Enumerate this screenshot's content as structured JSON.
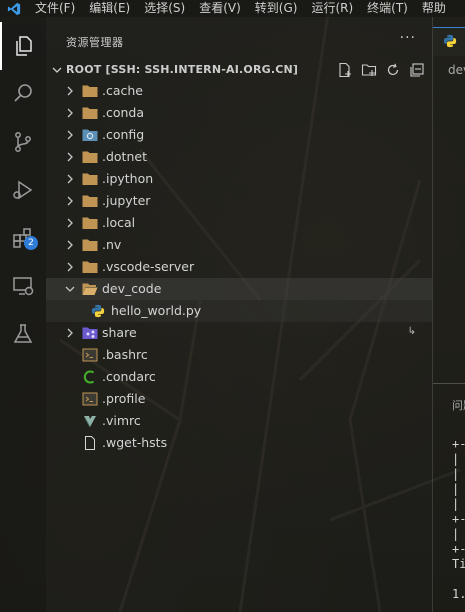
{
  "menubar": {
    "items": [
      "文件(F)",
      "编辑(E)",
      "选择(S)",
      "查看(V)",
      "转到(G)",
      "运行(R)",
      "终端(T)",
      "帮助"
    ]
  },
  "activitybar": {
    "extensions_badge": "2"
  },
  "sidebar": {
    "title": "资源管理器",
    "more": "···",
    "root_label": "ROOT [SSH: SSH.INTERN-AI.ORG.CN]",
    "items": [
      {
        "label": ".cache",
        "icon": "folder-icon"
      },
      {
        "label": ".conda",
        "icon": "folder-icon"
      },
      {
        "label": ".config",
        "icon": "config-folder-icon"
      },
      {
        "label": ".dotnet",
        "icon": "folder-icon"
      },
      {
        "label": ".ipython",
        "icon": "folder-icon"
      },
      {
        "label": ".jupyter",
        "icon": "folder-icon"
      },
      {
        "label": ".local",
        "icon": "folder-icon"
      },
      {
        "label": ".nv",
        "icon": "folder-icon"
      },
      {
        "label": ".vscode-server",
        "icon": "folder-icon"
      },
      {
        "label": "dev_code",
        "icon": "folder-open-icon"
      },
      {
        "label": "hello_world.py",
        "icon": "python-icon"
      },
      {
        "label": "share",
        "icon": "share-folder-icon"
      },
      {
        "label": ".bashrc",
        "icon": "terminal-file-icon"
      },
      {
        "label": ".condarc",
        "icon": "conda-file-icon"
      },
      {
        "label": ".profile",
        "icon": "terminal-file-icon"
      },
      {
        "label": ".vimrc",
        "icon": "vim-file-icon"
      },
      {
        "label": ".wget-hsts",
        "icon": "file-icon"
      }
    ]
  },
  "editor": {
    "breadcrumb": "dev",
    "panel_title": "问题",
    "terminal_lines": [
      "+-",
      "|",
      "|",
      "|",
      "|",
      "+-",
      "|",
      "+-",
      "Ti",
      "",
      "1."
    ]
  },
  "colors": {
    "accent": "#2e7dd8",
    "folder": "#c09553",
    "python_blue": "#3572a5",
    "python_yellow": "#f5d33c"
  }
}
